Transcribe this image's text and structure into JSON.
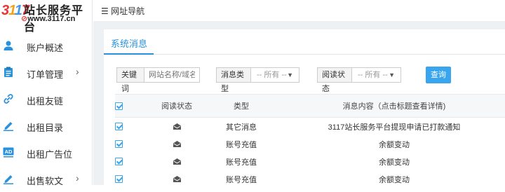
{
  "brand": {
    "logo_mark": [
      "3",
      "1",
      "1",
      "7"
    ],
    "name": "站长服务平台",
    "url": "www.3117.cn",
    "accent": "#e33333"
  },
  "sidebar": {
    "items": [
      {
        "label": "账户概述",
        "icon": "user-icon",
        "has_arrow": false
      },
      {
        "label": "订单管理",
        "icon": "clipboard-icon",
        "has_arrow": true,
        "arrow": "›"
      },
      {
        "label": "出租友链",
        "icon": "link-icon",
        "has_arrow": false
      },
      {
        "label": "出租目录",
        "icon": "edit-icon",
        "has_arrow": false
      },
      {
        "label": "出租广告位",
        "icon": "ad-icon",
        "has_arrow": false,
        "icon_text": "AD"
      },
      {
        "label": "出售软文",
        "icon": "pen-icon",
        "has_arrow": true,
        "arrow": "›"
      }
    ],
    "collapse_glyph": "‹",
    "icon_color": "#2a92dc"
  },
  "topbar": {
    "nav_label": "☰ 网址导航"
  },
  "tabs": [
    {
      "label": "系统消息",
      "active": true
    }
  ],
  "filters": {
    "keyword_label": "关键词",
    "keyword_placeholder": "网站名称/域名/I",
    "type_label": "消息类型",
    "type_value": "-- 所有 --",
    "status_label": "阅读状态",
    "status_value": "-- 所有 --",
    "query_button": "查询",
    "caret": "▼"
  },
  "table": {
    "columns": [
      "阅读状态",
      "类型",
      "消息内容（点击标题查看详情)"
    ],
    "rows": [
      {
        "type": "其它消息",
        "content": "3117站长服务平台提现申请已打款通知"
      },
      {
        "type": "账号充值",
        "content": "余额变动"
      },
      {
        "type": "账号充值",
        "content": "余额变动"
      },
      {
        "type": "账号充值",
        "content": "余额变动"
      }
    ]
  },
  "colors": {
    "primary": "#2a92dc",
    "button": "#3aa5ef",
    "background": "#eef1f4"
  }
}
